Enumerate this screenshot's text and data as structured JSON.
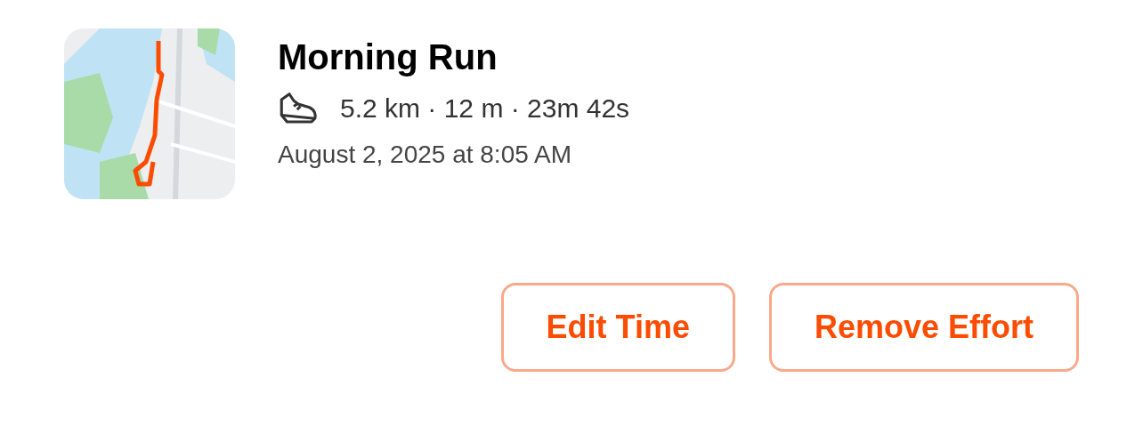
{
  "activity": {
    "title": "Morning Run",
    "stats": "5.2 km · 12 m · 23m 42s",
    "date": "August 2, 2025 at 8:05 AM"
  },
  "buttons": [
    {
      "label": "Edit Time"
    },
    {
      "label": "Remove Effort"
    }
  ]
}
